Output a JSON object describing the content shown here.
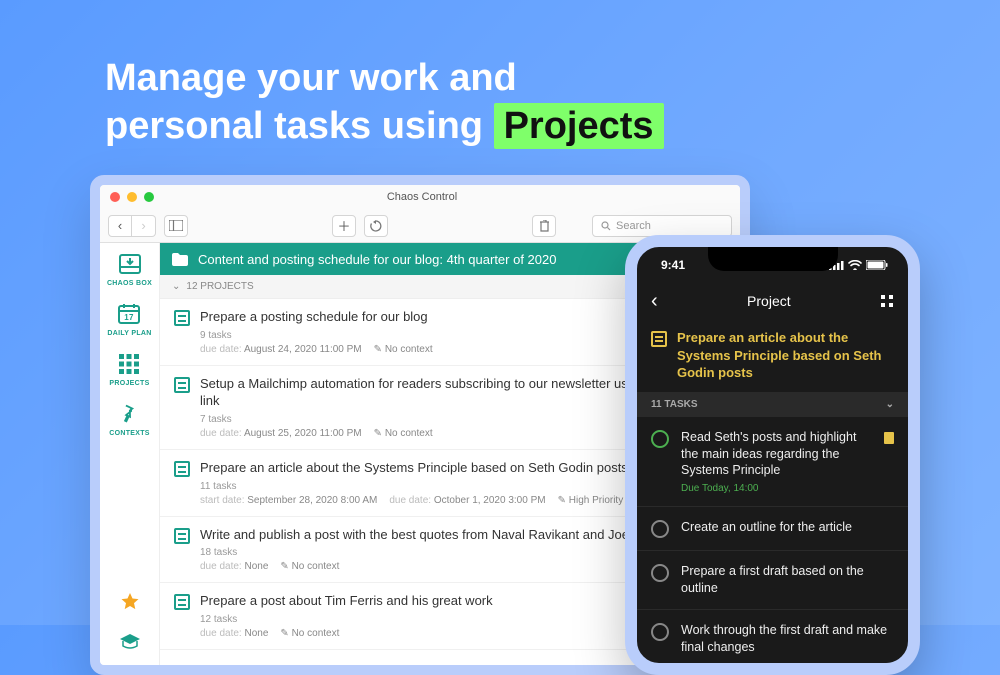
{
  "headline": {
    "line1": "Manage your work and",
    "line2_a": "personal tasks using ",
    "line2_b": "Projects"
  },
  "mac": {
    "title": "Chaos Control",
    "search_placeholder": "Search",
    "sidebar": [
      {
        "label": "CHAOS BOX"
      },
      {
        "label": "DAILY PLAN",
        "day": "17"
      },
      {
        "label": "PROJECTS"
      },
      {
        "label": "CONTEXTS"
      }
    ],
    "banner": "Content and posting schedule for our blog: 4th quarter of 2020",
    "projects_header": "12 PROJECTS",
    "due_label": "due date:",
    "start_label": "start date:",
    "nocontext": "No context",
    "projects": [
      {
        "title": "Prepare a posting schedule for our blog",
        "tasks": "9 tasks",
        "due": "August 24, 2020 11:00 PM",
        "context": "No context"
      },
      {
        "title": "Setup a Mailchimp automation for readers subscribing to our newsletter using the profile link",
        "tasks": "7 tasks",
        "due": "August 25, 2020 11:00 PM",
        "context": "No context"
      },
      {
        "title": "Prepare an article about the Systems Principle based on Seth Godin posts",
        "tasks": "11 tasks",
        "start": "September 28, 2020 8:00 AM",
        "due": "October 1, 2020 3:00 PM",
        "context": "High Priority"
      },
      {
        "title": "Write and publish a post with the best quotes from Naval Ravikant and Joe Rogan",
        "tasks": "18 tasks",
        "due": "None",
        "context": "No context"
      },
      {
        "title": "Prepare a post about Tim Ferris and his great work",
        "tasks": "12 tasks",
        "due": "None",
        "context": "No context"
      }
    ]
  },
  "phone": {
    "time": "9:41",
    "header": "Project",
    "title": "Prepare an article about the Systems Principle based on Seth Godin posts",
    "tasks_header": "11 TASKS",
    "tasks": [
      {
        "title": "Read Seth's posts and highlight the main ideas regarding the Systems Principle",
        "due": "Due Today, 14:00",
        "active": true,
        "note": true
      },
      {
        "title": "Create an outline for the article"
      },
      {
        "title": "Prepare a first draft based on the outline"
      },
      {
        "title": "Work through the first draft and make final changes"
      }
    ]
  }
}
